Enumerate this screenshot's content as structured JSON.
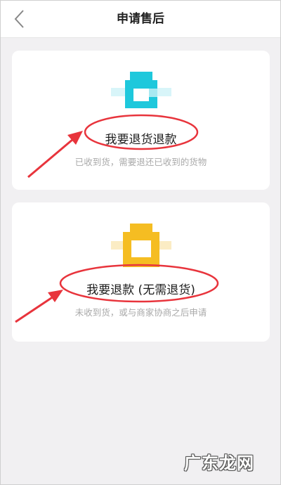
{
  "header": {
    "title": "申请售后"
  },
  "options": [
    {
      "label": "我要退货退款",
      "desc": "已收到货，需要退还已收到的货物",
      "icon": "return-box-icon",
      "color": "#1ec8dc"
    },
    {
      "label": "我要退款 (无需退货)",
      "desc": "未收到货，或与商家协商之后申请",
      "icon": "refund-box-icon",
      "color": "#f5bd22"
    }
  ],
  "annotation_color": "#e8343c",
  "watermark": "广东龙网"
}
